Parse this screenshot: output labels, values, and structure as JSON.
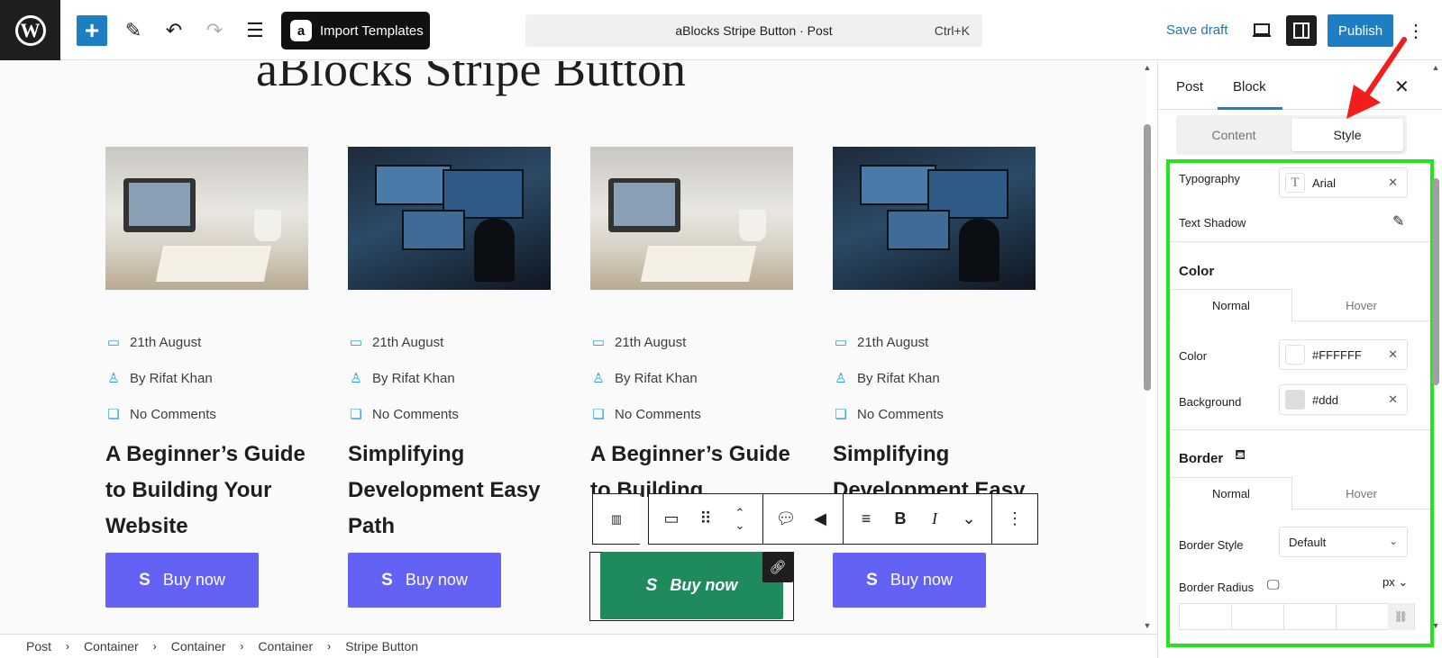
{
  "topbar": {
    "import_label": "Import Templates",
    "command_title": "aBlocks Stripe Button · Post",
    "command_shortcut": "Ctrl+K",
    "save_draft": "Save draft",
    "publish": "Publish",
    "icons": [
      "wordpress-logo",
      "plus-icon",
      "pencil-icon",
      "undo-icon",
      "redo-icon",
      "list-view-icon",
      "laptop-icon",
      "sidebar-icon",
      "more-vertical-icon"
    ]
  },
  "canvas": {
    "title": "aBlocks Stripe Button",
    "cards": [
      {
        "date": "21th August",
        "author": "By Rifat Khan",
        "comments": "No Comments",
        "heading": "A Beginner’s Guide to Building Your Website",
        "button": "Buy now",
        "image": "laptop-desk"
      },
      {
        "date": "21th August",
        "author": "By Rifat Khan",
        "comments": "No Comments",
        "heading": "Simplifying Development Easy Path",
        "button": "Buy now",
        "image": "developer-monitors"
      },
      {
        "date": "21th August",
        "author": "By Rifat Khan",
        "comments": "No Comments",
        "heading": "A Beginner’s Guide to Building",
        "button": "Buy now",
        "image": "laptop-desk"
      },
      {
        "date": "21th August",
        "author": "By Rifat Khan",
        "comments": "No Comments",
        "heading": "Simplifying Development Easy Path",
        "button": "Buy now",
        "image": "developer-monitors"
      }
    ],
    "button_color": "#6462f5",
    "selected_button_color": "#1f8a5b",
    "meta_icon_color": "#2f9fd8"
  },
  "breadcrumb": [
    "Post",
    "Container",
    "Container",
    "Container",
    "Stripe Button"
  ],
  "sidebar": {
    "tabs": [
      "Post",
      "Block"
    ],
    "segments": [
      "Content",
      "Style"
    ],
    "typography_label": "Typography",
    "typography_value": "Arial",
    "text_shadow_label": "Text Shadow",
    "color_section": "Color",
    "normal_label": "Normal",
    "hover_label": "Hover",
    "color_label": "Color",
    "color_value": "#FFFFFF",
    "background_label": "Background",
    "background_value": "#ddd",
    "border_section": "Border",
    "border_style_label": "Border Style",
    "border_style_value": "Default",
    "border_radius_label": "Border Radius",
    "unit": "px",
    "highlight_color": "#22e51b"
  }
}
